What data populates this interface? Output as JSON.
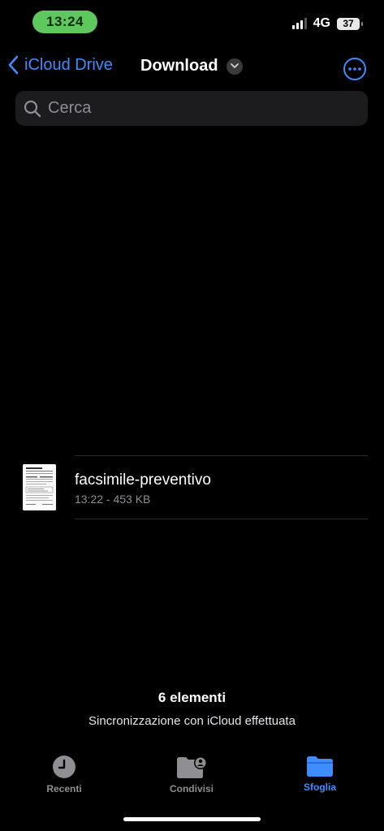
{
  "status_bar": {
    "time": "13:24",
    "network": "4G",
    "battery": "37"
  },
  "nav": {
    "back_label": "iCloud Drive",
    "title": "Download"
  },
  "search": {
    "placeholder": "Cerca"
  },
  "files": [
    {
      "name": "facsimile-preventivo",
      "meta": "13:22 - 453 KB"
    }
  ],
  "footer": {
    "items_count": "6 elementi",
    "sync_status": "Sincronizzazione con iCloud effettuata"
  },
  "tabs": [
    {
      "label": "Recenti",
      "icon": "clock-icon",
      "active": false
    },
    {
      "label": "Condivisi",
      "icon": "shared-folder-icon",
      "active": false
    },
    {
      "label": "Sfoglia",
      "icon": "folder-icon",
      "active": true
    }
  ],
  "colors": {
    "accent": "#3f8cff",
    "time_pill": "#5ec85e",
    "background": "#000000",
    "secondary_text": "#8e8e93"
  }
}
